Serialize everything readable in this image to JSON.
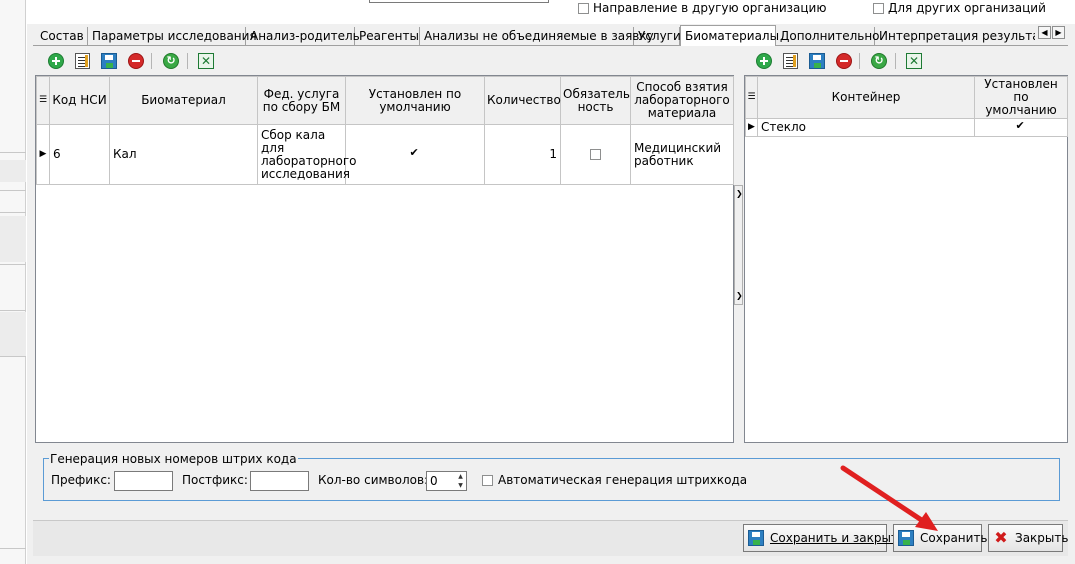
{
  "top_checks": [
    {
      "label": "Направление в другую организацию",
      "checked": false
    },
    {
      "label": "Для других организаций",
      "checked": false
    }
  ],
  "tabs": [
    {
      "label": "Состав"
    },
    {
      "label": "Параметры исследования"
    },
    {
      "label": "Анализ-родитель"
    },
    {
      "label": "Реагенты"
    },
    {
      "label": "Анализы не объединяемые в заявку"
    },
    {
      "label": "Услуги"
    },
    {
      "label": "Биоматериалы",
      "active": true
    },
    {
      "label": "Дополнительно"
    },
    {
      "label": "Интерпретация результатов"
    }
  ],
  "tab_scroll": {
    "left": "◀",
    "right": "▶"
  },
  "toolbar_icons": {
    "add": "add-icon",
    "edit": "edit-icon",
    "save": "save-icon",
    "delete": "delete-icon",
    "refresh": "refresh-icon",
    "excel": "excel-icon",
    "refresh_glyph": "↻",
    "excel_glyph": "✕"
  },
  "biomaterials": {
    "columns": {
      "code": "Код НСИ",
      "biomaterial": "Биоматериал",
      "fed_service": "Фед. услуга по сбору БМ",
      "default": "Установлен по умолчанию",
      "quantity": "Количество",
      "required": "Обязатель ность",
      "method": "Способ взятия лабораторного материала"
    },
    "rows": [
      {
        "code": "6",
        "biomaterial": "Кал",
        "fed_service": "Сбор кала для лабораторного исследования",
        "default": true,
        "quantity": "1",
        "required": false,
        "method": "Медицинский работник"
      }
    ]
  },
  "containers": {
    "columns": {
      "container": "Контейнер",
      "default": "Установлен по умолчанию"
    },
    "rows": [
      {
        "container": "Стекло",
        "default": true
      }
    ]
  },
  "barcode": {
    "group_title": "Генерация новых номеров штрих кода",
    "prefix_label": "Префикс:",
    "prefix_value": "",
    "postfix_label": "Постфикс:",
    "postfix_value": "",
    "chars_label": "Кол-во символов:",
    "chars_value": "0",
    "auto_label": "Автоматическая генерация штрихкода",
    "auto_checked": false
  },
  "buttons": {
    "save_close": "Сохранить и закрыть",
    "save": "Сохранить",
    "close": "Закрыть"
  },
  "colors": {
    "annotation_arrow": "#e02020",
    "groupbox_border": "#5b9bd5"
  }
}
